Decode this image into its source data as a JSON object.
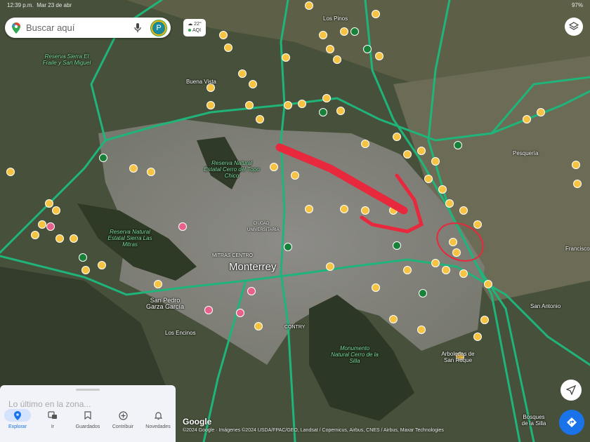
{
  "status_bar": {
    "time": "12:39 p.m.",
    "date": "Mar 23 de abr",
    "battery": "97%"
  },
  "search": {
    "placeholder": "Buscar aquí",
    "avatar_letter": "P"
  },
  "weather": {
    "temp": "22°",
    "aqi": "AQI"
  },
  "map_labels": [
    {
      "text": "Reserva Sierra El Fraile y San Miguel",
      "kind": "park"
    },
    {
      "text": "Reserva Natural Estatal Cerro del Topo Chico",
      "kind": "park"
    },
    {
      "text": "Reserva Natural Estatal Sierra Las Mitras",
      "kind": "park"
    },
    {
      "text": "Monterrey",
      "kind": "city"
    },
    {
      "text": "San Pedro Garza García",
      "kind": "place"
    },
    {
      "text": "Monumento Natural Cerro de la Silla",
      "kind": "park"
    },
    {
      "text": "MITRAS CENTRO",
      "kind": "place"
    },
    {
      "text": "CIUDAD UNIVERSITARIA",
      "kind": "place"
    },
    {
      "text": "Los Encinos",
      "kind": "place"
    },
    {
      "text": "CONTRY",
      "kind": "place"
    },
    {
      "text": "Bosques de la Silla",
      "kind": "place"
    },
    {
      "text": "Arboledas de San Roque",
      "kind": "place"
    },
    {
      "text": "Pesquería",
      "kind": "place"
    },
    {
      "text": "San Antonio",
      "kind": "place"
    },
    {
      "text": "Francisco",
      "kind": "place"
    },
    {
      "text": "Buena Vista",
      "kind": "place"
    },
    {
      "text": "Los Pinos",
      "kind": "place"
    }
  ],
  "bottom_panel": {
    "latest": "Lo último en la zona...",
    "nav": [
      {
        "label": "Explorar",
        "icon": "pin-icon",
        "active": true
      },
      {
        "label": "Ir",
        "icon": "commute-icon"
      },
      {
        "label": "Guardados",
        "icon": "bookmark-icon"
      },
      {
        "label": "Contribuir",
        "icon": "add-circle-icon"
      },
      {
        "label": "Novedades",
        "icon": "bell-icon"
      }
    ]
  },
  "attribution": {
    "logo": "Google",
    "text": "©2024 Google · Imágenes ©2024 USDA/FPAC/GEO, Landsat / Copernicus, Airbus, CNES / Airbus, Maxar Technologies"
  },
  "colors": {
    "road": "#1fb57a",
    "marker": "#f6c343",
    "annotation": "#e8283c",
    "accent": "#1a73e8"
  }
}
